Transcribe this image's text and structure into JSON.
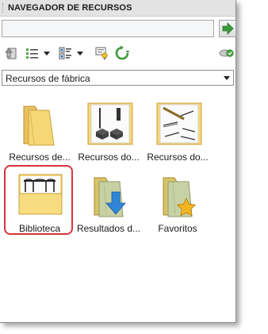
{
  "panel": {
    "title": "NAVEGADOR DE RECURSOS"
  },
  "search": {
    "value": "",
    "placeholder": ""
  },
  "toolbar": {
    "buttons": [
      {
        "icon": "home-back-icon"
      },
      {
        "icon": "list-view-icon"
      },
      {
        "icon": "list-view-dropdown-icon"
      },
      {
        "icon": "details-view-icon"
      },
      {
        "icon": "details-view-dropdown-icon"
      },
      {
        "icon": "lamp-hint-icon"
      },
      {
        "icon": "refresh-icon"
      }
    ],
    "status_icon": "connection-ok-icon"
  },
  "category_select": {
    "selected": "Recursos de fábrica"
  },
  "items": [
    {
      "label": "Recursos de...",
      "icon": "folder-icon"
    },
    {
      "label": "Recursos do...",
      "icon": "folder-columns-icon"
    },
    {
      "label": "Recursos do...",
      "icon": "folder-beams-icon"
    },
    {
      "label": "Biblioteca",
      "icon": "folder-library-icon",
      "selected": true
    },
    {
      "label": "Resultados d...",
      "icon": "folder-results-icon"
    },
    {
      "label": "Favoritos",
      "icon": "folder-favorites-icon"
    }
  ],
  "colors": {
    "accent_red": "#d8343d",
    "folder_yellow": "#f6d777",
    "go_green": "#3a9a3a"
  }
}
